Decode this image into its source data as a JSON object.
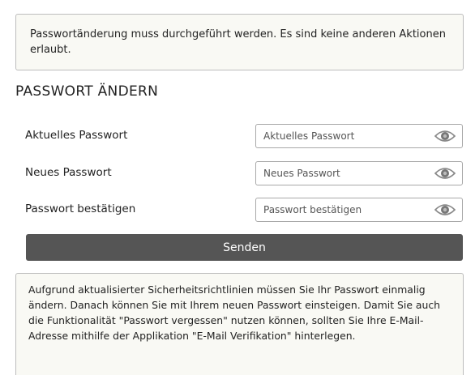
{
  "top_notice": {
    "text": "Passwortänderung muss durchgeführt werden. Es sind keine anderen Aktionen erlaubt."
  },
  "title": "PASSWORT ÄNDERN",
  "form": {
    "fields": [
      {
        "label": "Aktuelles Passwort",
        "placeholder": "Aktuelles Passwort",
        "value": "",
        "toggle_icon": "eye-icon"
      },
      {
        "label": "Neues Passwort",
        "placeholder": "Neues Passwort",
        "value": "",
        "toggle_icon": "eye-icon"
      },
      {
        "label": "Passwort bestätigen",
        "placeholder": "Passwort bestätigen",
        "value": "",
        "toggle_icon": "eye-icon"
      }
    ],
    "submit_label": "Senden"
  },
  "bottom_notice": {
    "text": "Aufgrund aktualisierter Sicherheitsrichtlinien müssen Sie Ihr Passwort einmalig ändern. Danach können Sie mit Ihrem neuen Passwort einsteigen. Damit Sie auch die Funktionalität \"Passwort vergessen\" nutzen können, sollten Sie Ihre E-Mail-Adresse mithilfe der Applikation \"E-Mail Verifikation\" hinterlegen."
  },
  "colors": {
    "notice_background": "#f9f9f4",
    "notice_border": "#bdbdbd",
    "button_background": "#555555",
    "button_text": "#ffffff",
    "input_border": "#a8a8a8"
  }
}
